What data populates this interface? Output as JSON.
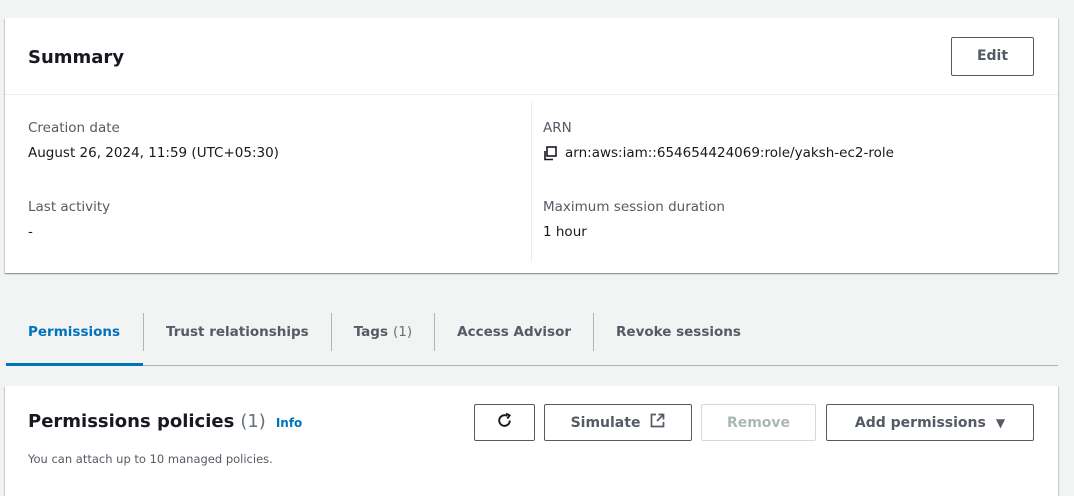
{
  "summary": {
    "title": "Summary",
    "edit_label": "Edit",
    "creation_date_label": "Creation date",
    "creation_date_value": "August 26, 2024, 11:59 (UTC+05:30)",
    "last_activity_label": "Last activity",
    "last_activity_value": "-",
    "arn_label": "ARN",
    "arn_value": "arn:aws:iam::654654424069:role/yaksh-ec2-role",
    "max_session_label": "Maximum session duration",
    "max_session_value": "1 hour"
  },
  "tabs": [
    {
      "label": "Permissions",
      "active": true
    },
    {
      "label": "Trust relationships"
    },
    {
      "label": "Tags",
      "count": "(1)"
    },
    {
      "label": "Access Advisor"
    },
    {
      "label": "Revoke sessions"
    }
  ],
  "policies": {
    "title": "Permissions policies",
    "count": "(1)",
    "info_label": "Info",
    "description": "You can attach up to 10 managed policies.",
    "simulate_label": "Simulate",
    "remove_label": "Remove",
    "add_label": "Add permissions"
  },
  "icons": {
    "refresh": "refresh-icon",
    "external": "external-link-icon",
    "copy": "copy-icon",
    "caret": "caret-down-icon"
  },
  "colors": {
    "accent": "#0073bb",
    "background": "#f2f3f3",
    "text": "#16191f",
    "muted": "#545b64"
  }
}
